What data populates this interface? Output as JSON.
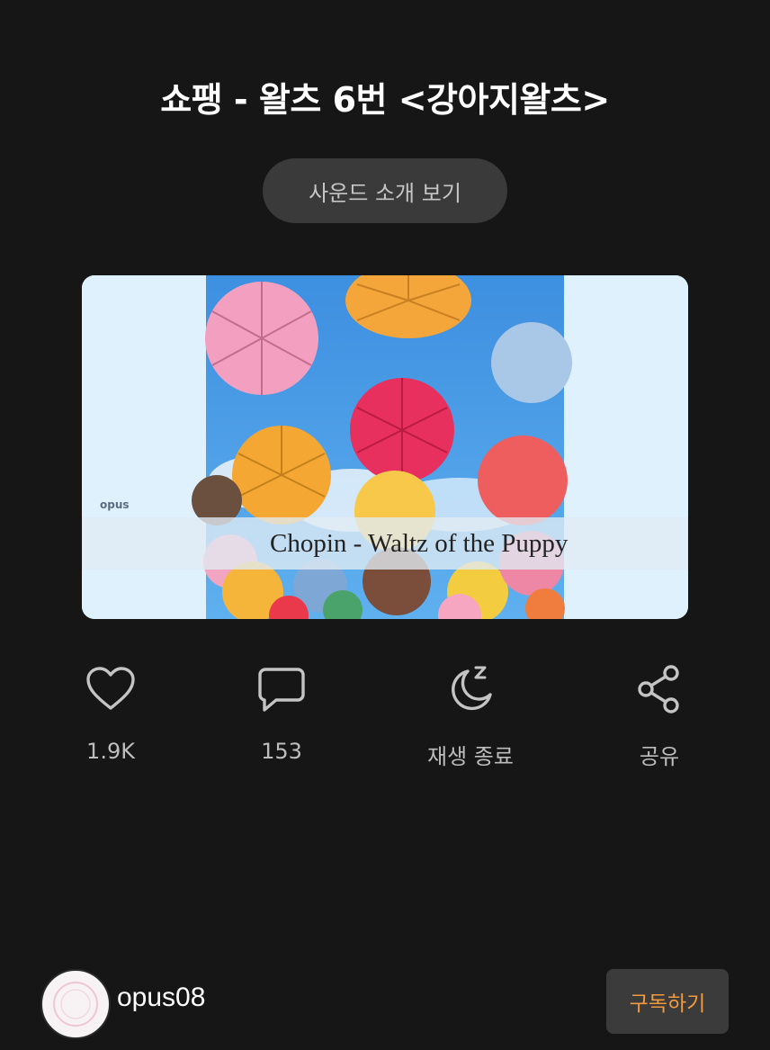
{
  "header": {
    "title": "쇼팽 - 왈츠 6번 <강아지왈츠>"
  },
  "intro_button": {
    "label": "사운드 소개 보기"
  },
  "thumbnail": {
    "watermark": "opus",
    "caption": "Chopin - Waltz of the Puppy"
  },
  "actions": [
    {
      "icon": "heart-icon",
      "label": "1.9K"
    },
    {
      "icon": "comment-icon",
      "label": "153"
    },
    {
      "icon": "sleep-timer-icon",
      "label": "재생 종료"
    },
    {
      "icon": "share-icon",
      "label": "공유"
    }
  ],
  "footer": {
    "username": "opus08",
    "subscribe_label": "구독하기"
  },
  "colors": {
    "background": "#161616",
    "accent": "#f19a3e",
    "button_bg": "#3a3a3a"
  }
}
